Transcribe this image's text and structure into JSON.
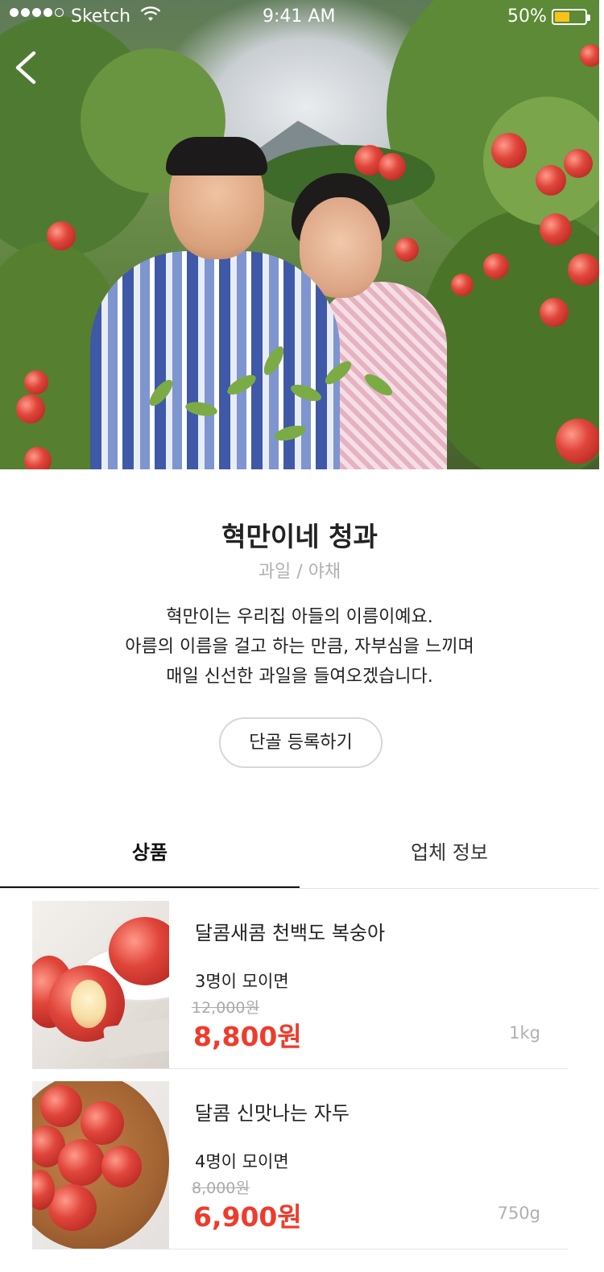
{
  "status_bar": {
    "carrier": "Sketch",
    "time": "9:41 AM",
    "battery_percent": "50%",
    "battery_level": 0.5,
    "signal_bars_filled": 4,
    "signal_bars_total": 5,
    "battery_color": "#f7c21a"
  },
  "header": {
    "back_icon": "chevron-left-icon"
  },
  "shop": {
    "name": "혁만이네 청과",
    "category": "과일 / 야채",
    "description_lines": [
      "혁만이는 우리집 아들의 이름이예요.",
      "아름의 이름을 걸고 하는 만큼, 자부심을 느끼며",
      "매일 신선한 과일을 들여오겠습니다."
    ],
    "regular_button_label": "단골 등록하기"
  },
  "tabs": [
    {
      "label": "상품",
      "active": true
    },
    {
      "label": "업체 정보",
      "active": false
    }
  ],
  "products": [
    {
      "name": "달콤새콤 천백도 복숭아",
      "group_text": "3명이 모이면",
      "original_price": "12,000원",
      "price": "8,800원",
      "weight": "1kg"
    },
    {
      "name": "달콤 신맛나는 자두",
      "group_text": "4명이 모이면",
      "original_price": "8,000원",
      "price": "6,900원",
      "weight": "750g"
    }
  ],
  "colors": {
    "accent_price": "#ef3b2b",
    "muted_text": "#b0b0b0",
    "tab_active_underline": "#111111"
  }
}
